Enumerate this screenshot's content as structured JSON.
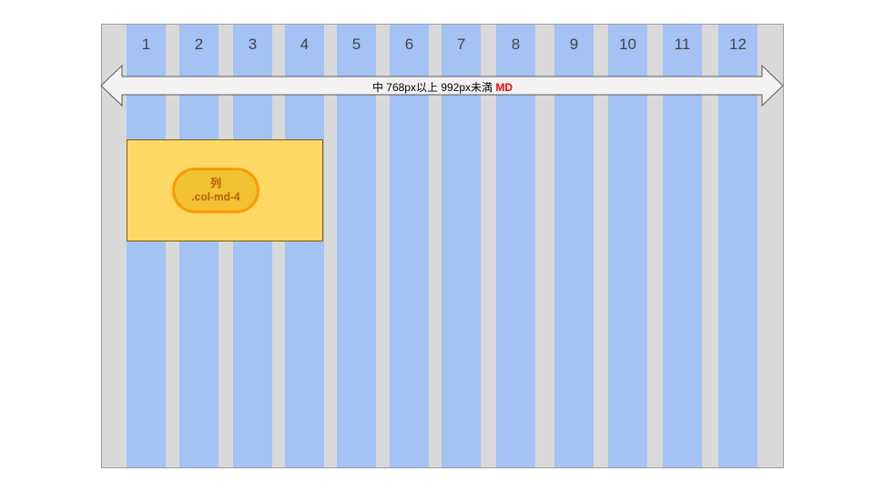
{
  "grid": {
    "columns": [
      "1",
      "2",
      "3",
      "4",
      "5",
      "6",
      "7",
      "8",
      "9",
      "10",
      "11",
      "12"
    ]
  },
  "breakpoint": {
    "label": "中 768px以上 992px未満",
    "tag": "MD"
  },
  "column_example": {
    "title": "列",
    "class_name": ".col-md-4"
  },
  "colors": {
    "container": "#d9d9d9",
    "column": "#a4c2f4",
    "highlight": "#ffd966",
    "pill_fill": "#f1c232",
    "pill_border": "#ff9900",
    "tag": "#ff0000"
  }
}
